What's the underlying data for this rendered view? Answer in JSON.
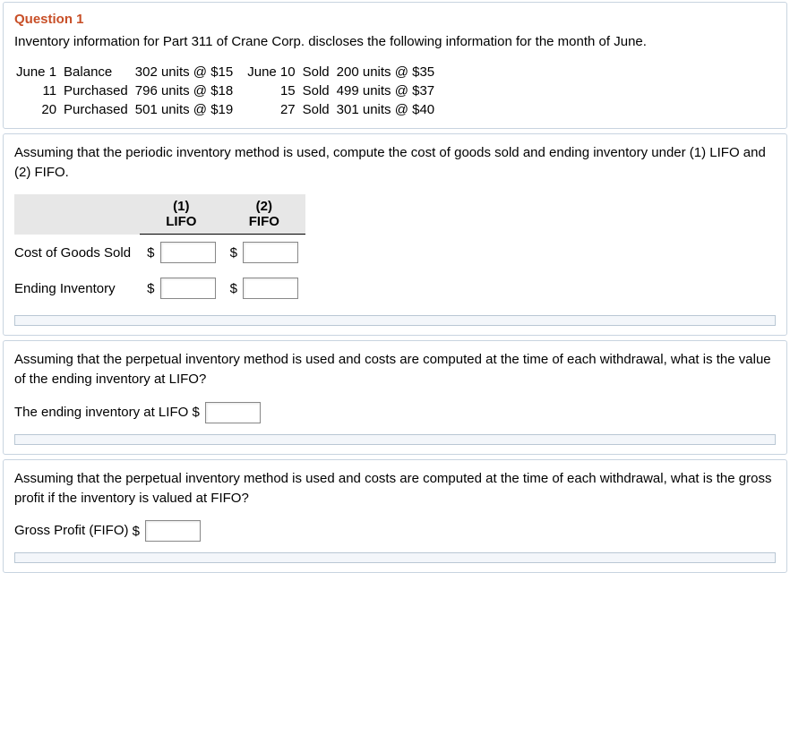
{
  "question": {
    "title": "Question 1",
    "intro": "Inventory information for Part 311 of Crane Corp. discloses the following information for the month of June."
  },
  "ledger": [
    {
      "ldate": "June 1",
      "laction": "Balance",
      "ldetail": "302 units @ $15",
      "rdate": "June 10",
      "raction": "Sold",
      "rdetail": "200 units @ $35"
    },
    {
      "ldate": "11",
      "laction": "Purchased",
      "ldetail": "796 units @ $18",
      "rdate": "15",
      "raction": "Sold",
      "rdetail": "499 units @ $37"
    },
    {
      "ldate": "20",
      "laction": "Purchased",
      "ldetail": "501 units @ $19",
      "rdate": "27",
      "raction": "Sold",
      "rdetail": "301 units @ $40"
    }
  ],
  "part2": {
    "instr": "Assuming that the periodic inventory method is used, compute the cost of goods sold and ending inventory under (1) LIFO and (2) FIFO.",
    "col1_top": "(1)",
    "col1_bot": "LIFO",
    "col2_top": "(2)",
    "col2_bot": "FIFO",
    "row1": "Cost of Goods Sold",
    "row2": "Ending Inventory",
    "dollar": "$"
  },
  "part3": {
    "instr": "Assuming that the perpetual inventory method is used and costs are computed at the time of each withdrawal, what is the value of the ending inventory at LIFO?",
    "prompt": "The ending inventory at LIFO",
    "dollar": "$"
  },
  "part4": {
    "instr": "Assuming that the perpetual inventory method is used and costs are computed at the time of each withdrawal, what is the gross profit if the inventory is valued at FIFO?",
    "prompt": "Gross Profit (FIFO)",
    "dollar": "$"
  }
}
